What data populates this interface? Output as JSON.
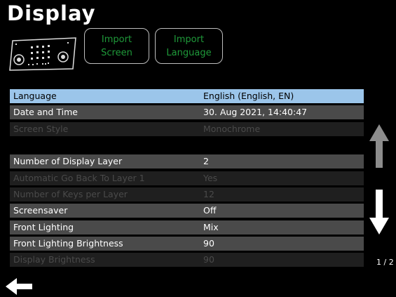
{
  "header": {
    "title": "Display"
  },
  "device_image": {
    "icon": "controller-device-icon"
  },
  "buttons": {
    "import_screen": {
      "line1": "Import",
      "line2": "Screen"
    },
    "import_language": {
      "line1": "Import",
      "line2": "Language"
    }
  },
  "settings": [
    {
      "label": "Language",
      "value": "English (English, EN)",
      "state": "selected"
    },
    {
      "label": "Date and Time",
      "value": "30. Aug 2021, 14:40:47",
      "state": "enabled"
    },
    {
      "label": "Screen Style",
      "value": "Monochrome",
      "state": "disabled"
    },
    {
      "label": "Number of Display Layer",
      "value": "2",
      "state": "enabled"
    },
    {
      "label": "Automatic Go Back To Layer 1",
      "value": "Yes",
      "state": "disabled"
    },
    {
      "label": "Number of Keys per Layer",
      "value": "12",
      "state": "disabled"
    },
    {
      "label": "Screensaver",
      "value": "Off",
      "state": "enabled"
    },
    {
      "label": "Front Lighting",
      "value": "Mix",
      "state": "enabled"
    },
    {
      "label": "Front Lighting Brightness",
      "value": "90",
      "state": "enabled"
    },
    {
      "label": "Display Brightness",
      "value": "90",
      "state": "disabled"
    }
  ],
  "navigation": {
    "page_indicator": "1 / 2",
    "up_icon": "arrow-up-icon",
    "down_icon": "arrow-down-icon",
    "back_icon": "arrow-left-icon"
  },
  "colors": {
    "selected": "#9bc5ea",
    "enabled": "#4a4a4a",
    "disabled": "#1f1f1f",
    "disabled_text": "#4a4a4a",
    "button_text": "#1f9a3a",
    "arrow_up_dim": "#8c8c8c"
  }
}
